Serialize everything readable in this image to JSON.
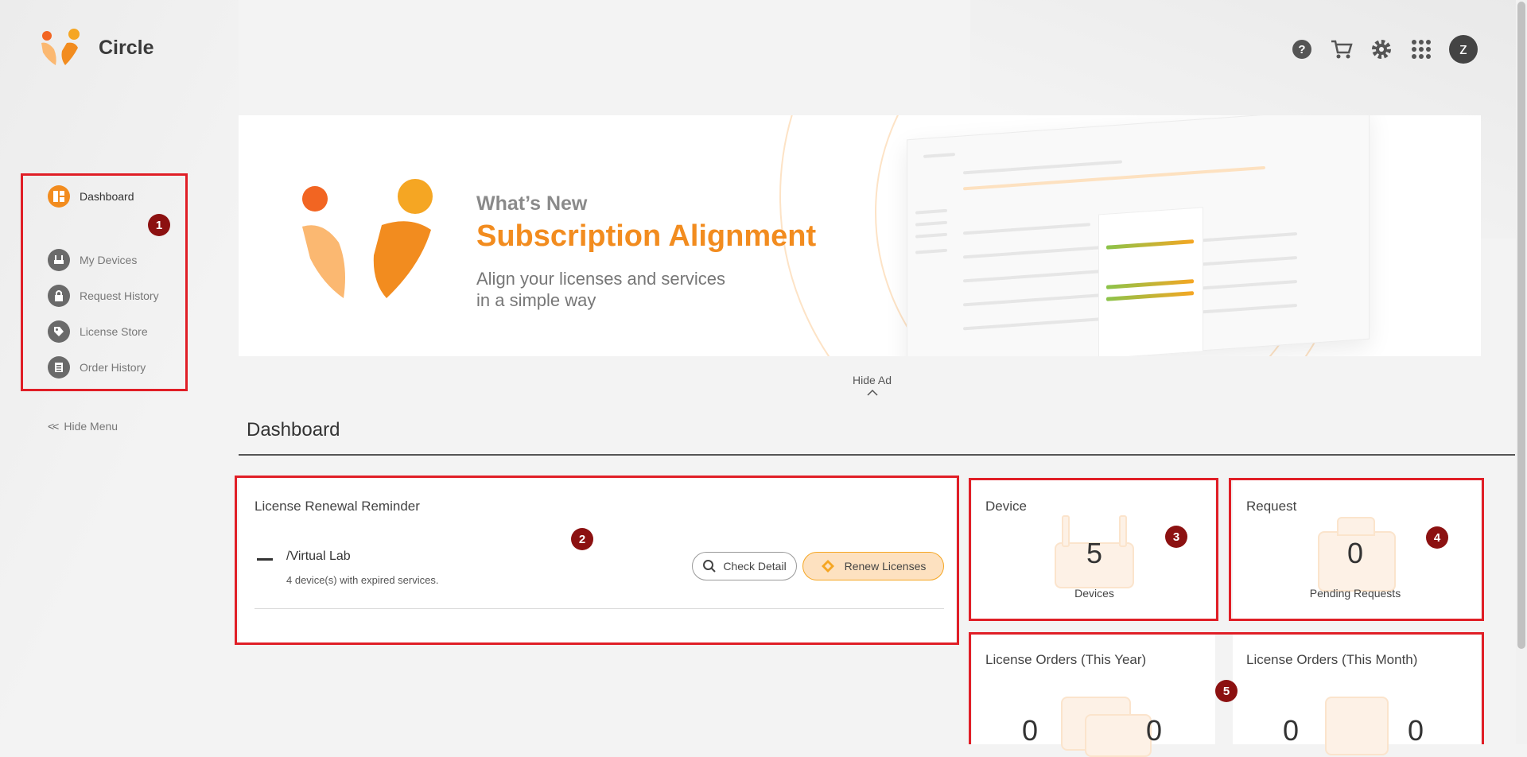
{
  "app": {
    "name": "Circle"
  },
  "header": {
    "icons": [
      "help-icon",
      "cart-icon",
      "settings-icon",
      "apps-grid-icon"
    ],
    "avatar_letter": "z"
  },
  "sidebar": {
    "items": [
      {
        "label": "Dashboard",
        "icon": "dashboard-icon",
        "active": true
      },
      {
        "label": "My Devices",
        "icon": "router-icon",
        "active": false
      },
      {
        "label": "Request History",
        "icon": "lock-icon",
        "active": false
      },
      {
        "label": "License Store",
        "icon": "tag-icon",
        "active": false
      },
      {
        "label": "Order History",
        "icon": "list-icon",
        "active": false
      }
    ],
    "hide_menu": "Hide Menu"
  },
  "banner": {
    "kicker": "What’s New",
    "title": "Subscription Alignment",
    "subtitle_line1": "Align your licenses and services",
    "subtitle_line2": "in a simple way"
  },
  "hide_ad": "Hide Ad",
  "page_title": "Dashboard",
  "markers": [
    "1",
    "2",
    "3",
    "4",
    "5"
  ],
  "renewal": {
    "title": "License Renewal Reminder",
    "org_name": "/Virtual Lab",
    "description": "4 device(s) with expired services.",
    "check_detail": "Check Detail",
    "renew_licenses": "Renew Licenses"
  },
  "device_card": {
    "title": "Device",
    "count": "5",
    "label": "Devices"
  },
  "request_card": {
    "title": "Request",
    "count": "0",
    "label": "Pending Requests"
  },
  "orders_year": {
    "title": "License Orders (This Year)",
    "value_a": "0",
    "value_b": "0"
  },
  "orders_month": {
    "title": "License Orders (This Month)",
    "value_a": "0",
    "value_b": "0"
  },
  "colors": {
    "accent": "#f28c1f",
    "highlight_box": "#e01e26",
    "marker": "#8c1111"
  }
}
